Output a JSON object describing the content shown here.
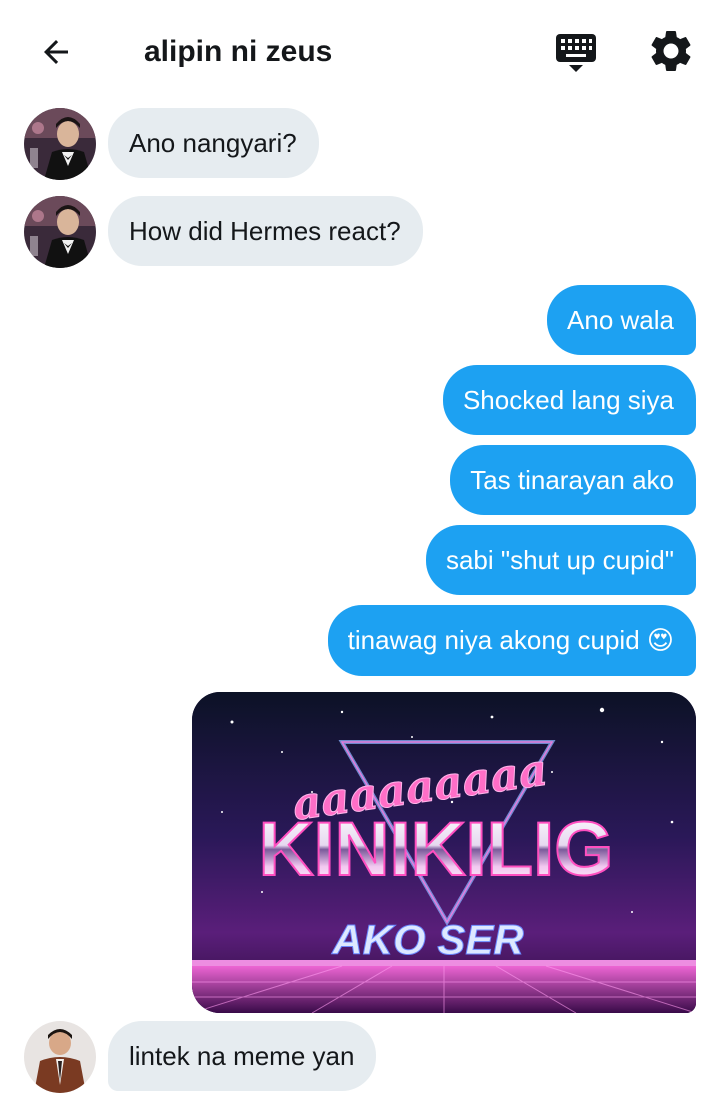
{
  "header": {
    "title": "alipin ni zeus",
    "back_icon": "arrow-left-icon",
    "keyboard_icon": "keyboard-icon",
    "settings_icon": "gear-icon"
  },
  "messages": {
    "m1": "Ano nangyari?",
    "m2": "How did Hermes react?",
    "m3": "Ano wala",
    "m4": "Shocked lang siya",
    "m5": "Tas tinarayan ako",
    "m6": "sabi \"shut up cupid\"",
    "m7": "tinawag niya akong cupid",
    "m7_emoji": "😍",
    "m9": "lintek na meme yan"
  },
  "meme": {
    "line1": "aaaaaaaaa",
    "line2": "KINIKILIG",
    "line3": "AKO SER"
  },
  "colors": {
    "outgoing": "#1da1f2",
    "incoming": "#e6ecf0",
    "text": "#14171a"
  }
}
